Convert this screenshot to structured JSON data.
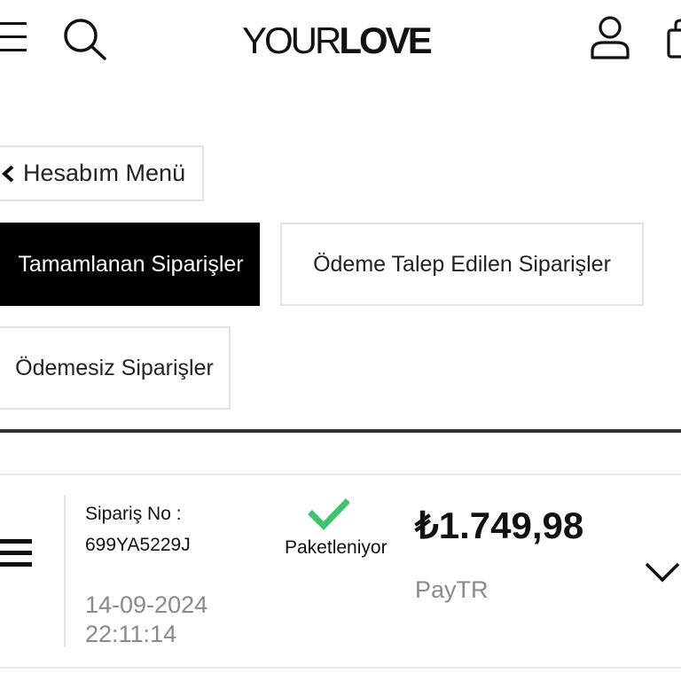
{
  "header": {
    "logo_light": "YOUR",
    "logo_bold": "LOVE",
    "icons": [
      "menu-icon",
      "search-icon",
      "user-icon",
      "bag-icon"
    ]
  },
  "account_menu": {
    "back_label": "Hesabım Menü"
  },
  "tabs": [
    {
      "label": "Tamamlanan Siparişler",
      "active": true
    },
    {
      "label": "Ödeme Talep Edilen Siparişler",
      "active": false
    },
    {
      "label": "Ödemesiz Siparişler",
      "active": false
    }
  ],
  "order": {
    "number_label": "Sipariş No :",
    "number": "699YA5229J",
    "date": "14-09-2024",
    "time": "22:11:14",
    "status": "Paketleniyor",
    "price": "₺1.749,98",
    "payment_method": "PayTR"
  },
  "colors": {
    "accent_active_tab": "#000000",
    "status_check": "#3ec46d",
    "muted_text": "#8a8a8a",
    "border": "#e3e3e3"
  }
}
